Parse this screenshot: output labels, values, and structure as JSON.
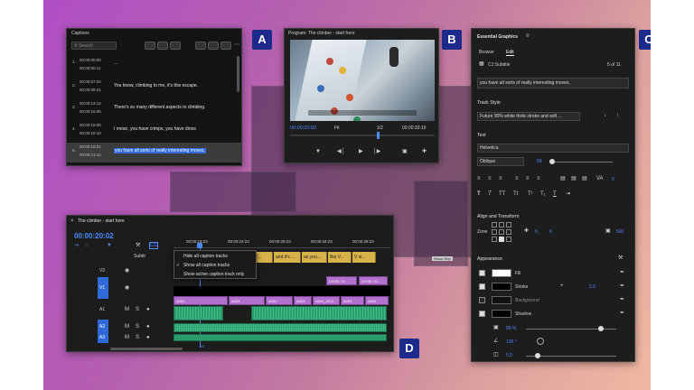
{
  "badges": {
    "a": "A",
    "b": "B",
    "c": "C",
    "d": "D"
  },
  "captions": {
    "title": "Captions",
    "search_placeholder": "Search",
    "items": [
      {
        "num": "1.",
        "tc_in": "00:00:00:00",
        "tc_out": "00:00:00:11",
        "text": "..."
      },
      {
        "num": "2.",
        "tc_in": "00:00:07:04",
        "tc_out": "00:00:09:21",
        "text": "You know, climbing to me, it's this escape."
      },
      {
        "num": "3.",
        "tc_in": "00:00:13:14",
        "tc_out": "00:00:15:05",
        "text": "There's so many different aspects to climbing."
      },
      {
        "num": "4.",
        "tc_in": "00:00:15:05",
        "tc_out": "00:00:16:10",
        "text": "I mean, you have crimps, you have dinos"
      },
      {
        "num": "5.",
        "tc_in": "00:00:18:01",
        "tc_out": "00:00:21:12",
        "text": "you have all sorts of really interesting moves,"
      }
    ]
  },
  "program": {
    "title": "Program: The climber - start here",
    "timecode_current": "00:00:20:02",
    "fit_label": "Fit",
    "quality_label": "1/2",
    "timecode_total": "00:00:33:19"
  },
  "essential_graphics": {
    "title": "Essential Graphics",
    "tab_browse": "Browse",
    "tab_edit": "Edit",
    "layer_name": "C1:Subtitle",
    "layer_count": "5 of 11",
    "caption_text": "you have all sorts of really interesting moves,",
    "track_style_label": "Track Style",
    "track_style_value": "Future 90% white think stroke and soft ...",
    "text_label": "Text",
    "font": "Helvetica",
    "font_style": "Oblique",
    "font_size": "59",
    "tracking": "0",
    "align_label": "Align and Transform",
    "zone_label": "Zone",
    "pos_x": "0,",
    "pos_y": "0",
    "scale": "500",
    "appearance_label": "Appearance",
    "fill_label": "Fill",
    "stroke_label": "Stroke",
    "stroke_value": "2.0",
    "background_label": "Background",
    "shadow_label": "Shadow",
    "opacity": "80 %",
    "angle": "135 °",
    "distance": "5.0"
  },
  "timeline": {
    "title": "The climber - start here",
    "timecode": "00:00:20:02",
    "ruler": [
      "00:00:19:23",
      "00:00:24:23",
      "00:00:29:23",
      "00:00:34:23",
      "00:00:39:23"
    ],
    "subtitle_track": "Subtit",
    "tracks": [
      "V2",
      "V1",
      "A1",
      "A2",
      "A3"
    ],
    "captions": [
      "Y...",
      "and it's ...",
      "as you...",
      "like V...",
      "V si..."
    ],
    "level_clips": [
      "LEVEL V1",
      "LEVEL V1"
    ],
    "a_clips": [
      "A001",
      "A003",
      "A001",
      "A003",
      "A003_2012",
      "A003",
      "A003"
    ],
    "menu": [
      {
        "label": "Hide all caption tracks",
        "checked": false
      },
      {
        "label": "Show all caption tracks",
        "checked": true
      },
      {
        "label": "Show active caption track only",
        "checked": false
      }
    ],
    "playhead_marker": "40"
  },
  "bg_tooltip": "Show Grip"
}
